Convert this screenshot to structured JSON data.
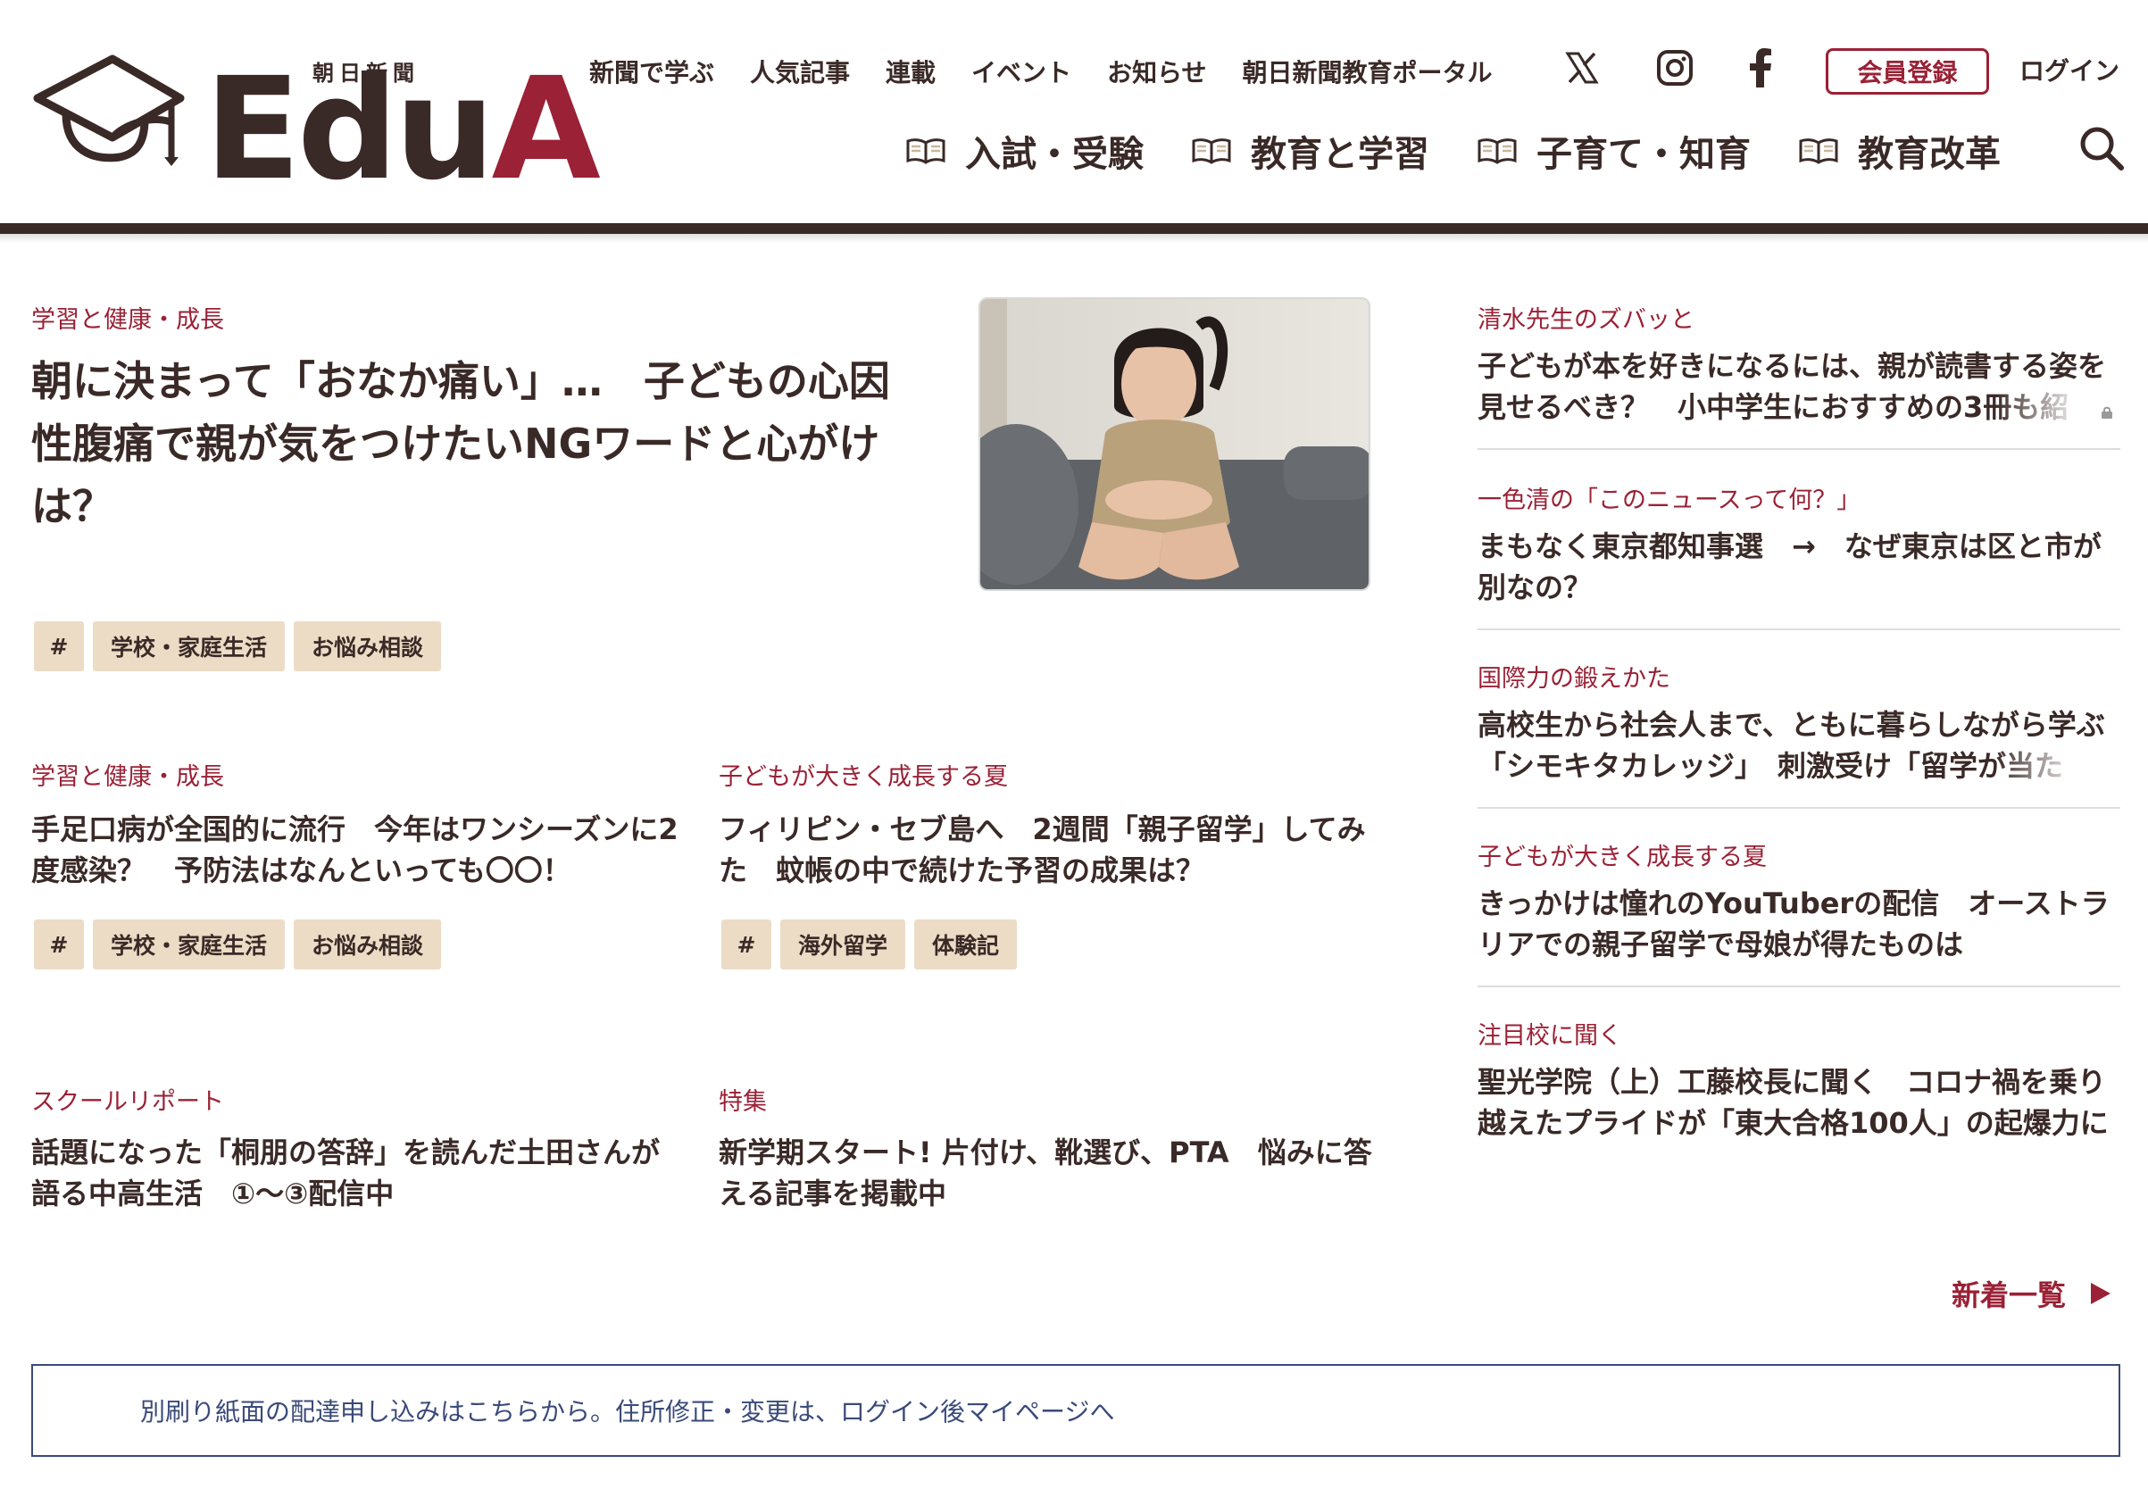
{
  "logo": {
    "sub": "朝日新聞",
    "word_main": "Edu",
    "word_accent": "A"
  },
  "top_nav": [
    "新聞で学ぶ",
    "人気記事",
    "連載",
    "イベント",
    "お知らせ",
    "朝日新聞教育ポータル"
  ],
  "social_icons": [
    "x-icon",
    "instagram-icon",
    "facebook-icon"
  ],
  "account": {
    "register": "会員登録",
    "login": "ログイン"
  },
  "main_nav": [
    "入試・受験",
    "教育と学習",
    "子育て・知育",
    "教育改革"
  ],
  "hero": {
    "category": "学習と健康・成長",
    "title_lines": [
      "朝に決まって「おなか痛い」…　子どもの心因",
      "性腹痛で親が気をつけたいNGワードと心がけ",
      "は？"
    ],
    "tags": [
      "#",
      "学校・家庭生活",
      "お悩み相談"
    ]
  },
  "articles": [
    {
      "category": "学習と健康・成長",
      "title_lines": [
        "手足口病が全国的に流行　今年はワンシーズンに2",
        "度感染？　予防法はなんといっても〇〇！"
      ],
      "tags": [
        "#",
        "学校・家庭生活",
        "お悩み相談"
      ]
    },
    {
      "category": "子どもが大きく成長する夏",
      "title_lines": [
        "フィリピン・セブ島へ　2週間「親子留学」してみ",
        "た　蚊帳の中で続けた予習の成果は？"
      ],
      "tags": [
        "#",
        "海外留学",
        "体験記"
      ]
    },
    {
      "category": "スクールリポート",
      "title_lines": [
        "話題になった「桐朋の答辞」を読んだ土田さんが",
        "語る中高生活　①〜③配信中"
      ],
      "tags": []
    },
    {
      "category": "特集",
      "title_lines": [
        "新学期スタート! 片付け、靴選び、PTA　悩みに答",
        "える記事を掲載中"
      ],
      "tags": []
    }
  ],
  "sidebar": [
    {
      "category": "清水先生のズバッと",
      "title_lines": [
        "子どもが本を好きになるには、親が読書する姿を",
        "見せるべき？　小中学生におすすめの3冊も紹"
      ],
      "locked": true
    },
    {
      "category": "一色清の「このニュースって何？」",
      "title_lines": [
        "まもなく東京都知事選　→　なぜ東京は区と市が",
        "別なの？"
      ],
      "locked": false
    },
    {
      "category": "国際力の鍛えかた",
      "title_lines": [
        "高校生から社会人まで、ともに暮らしながら学ぶ",
        "「シモキタカレッジ」　刺激受け「留学が当た"
      ],
      "locked": false
    },
    {
      "category": "子どもが大きく成長する夏",
      "title_lines": [
        "きっかけは憧れのYouTuberの配信　オーストラ",
        "リアでの親子留学で母娘が得たものは"
      ],
      "locked": false
    },
    {
      "category": "注目校に聞く",
      "title_lines": [
        "聖光学院（上）工藤校長に聞く　コロナ禍を乗り",
        "越えたプライドが「東大合格100人」の起爆力に"
      ],
      "locked": false
    }
  ],
  "more_link": "新着一覧",
  "notice": "別刷り紙面の配達申し込みはこちらから。住所修正・変更は、ログイン後マイページへ",
  "colors": {
    "accent": "#9a2136",
    "text": "#3a2a27",
    "tag_bg": "#ecdcc6",
    "notice_border": "#3a4a7a"
  }
}
